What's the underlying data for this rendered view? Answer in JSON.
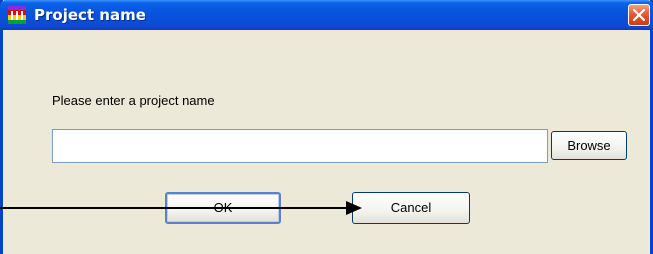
{
  "window": {
    "title": "Project name",
    "app_icon": "flag-icon",
    "close_icon": "close-icon"
  },
  "dialog": {
    "prompt": "Please enter a project name",
    "input_value": "",
    "input_placeholder": ""
  },
  "buttons": {
    "browse_label": "Browse",
    "ok_label": "OK",
    "cancel_label": "Cancel"
  },
  "colors": {
    "titlebar": "#0853dc",
    "window_border": "#0842c8",
    "dialog_background": "#ece9d8",
    "close_button": "#e35a35"
  }
}
